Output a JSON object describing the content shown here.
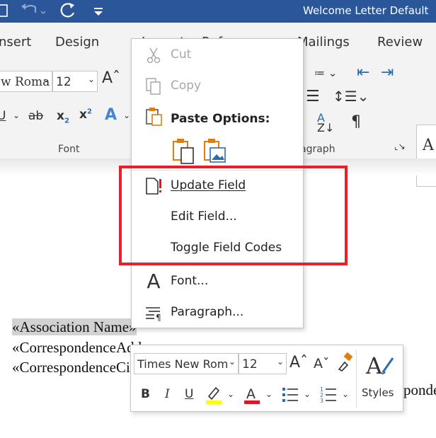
{
  "titlebar": {
    "title": "Welcome Letter Default",
    "bg_color": "#2b579a",
    "icons": [
      "save-icon",
      "undo-icon",
      "redo-icon",
      "customize-qat-icon"
    ]
  },
  "ribbon": {
    "tabs": [
      {
        "label": "nsert"
      },
      {
        "label": "Design"
      },
      {
        "label": "Layout"
      },
      {
        "label": "References"
      },
      {
        "label": "Mailings"
      },
      {
        "label": "Review"
      }
    ],
    "font_name": "w Roma",
    "font_size": "12",
    "font_group_label": "Font",
    "paragraph_group_label": "agraph",
    "styles_preview": "A",
    "styles_sub": "¶ l"
  },
  "context_menu": {
    "items": {
      "cut": {
        "label": "Cut",
        "icon": "scissors-icon",
        "enabled": false
      },
      "copy": {
        "label": "Copy",
        "icon": "copy-icon",
        "enabled": false
      },
      "paste_options": {
        "label": "Paste Options:",
        "icon": "paste-icon"
      },
      "update_field": {
        "label": "Update Field",
        "icon": "update-field-icon"
      },
      "edit_field": {
        "label": "Edit Field..."
      },
      "toggle_field_codes": {
        "label": "Toggle Field Codes"
      },
      "font": {
        "label": "Font...",
        "icon": "font-icon"
      },
      "paragraph": {
        "label": "Paragraph...",
        "icon": "paragraph-icon"
      }
    },
    "highlight_color": "#e8202a"
  },
  "document": {
    "lines": [
      "«Association Name»",
      "«CorrespondenceAddress»",
      "«CorrespondenceCityStateZip»"
    ],
    "line3_tail": "ponde"
  },
  "mini_toolbar": {
    "font_name": "Times New Rom",
    "font_size": "12",
    "styles_label": "Styles",
    "highlight_color": "#ffff00",
    "font_color": "#e81123"
  }
}
